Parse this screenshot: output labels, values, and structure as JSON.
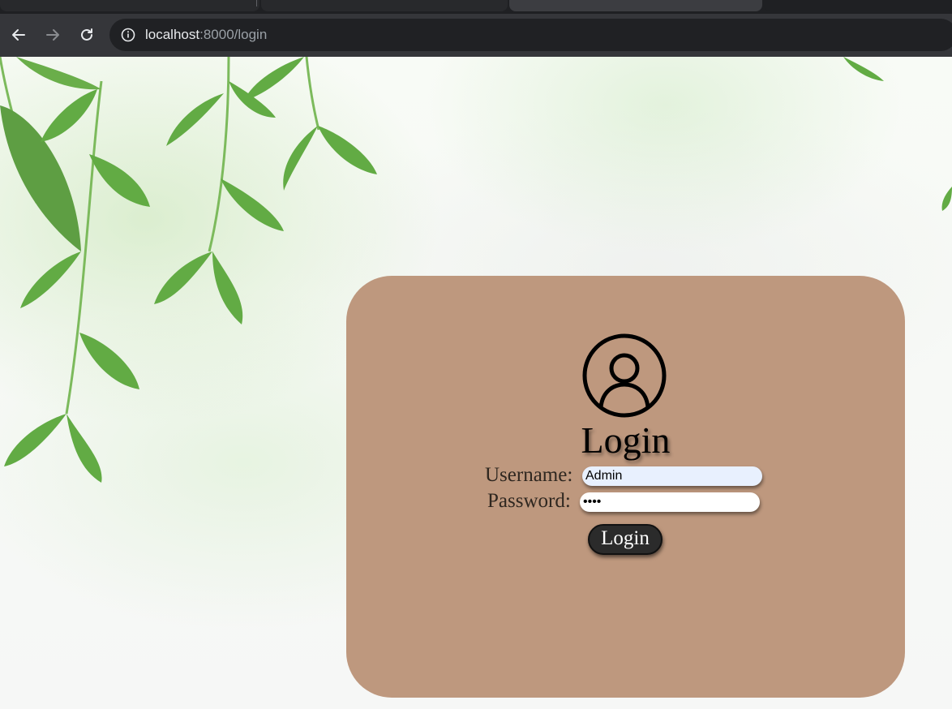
{
  "browser": {
    "url_host": "localhost",
    "url_path": ":8000/login",
    "icons": {
      "back": "arrow-left-icon",
      "forward": "arrow-right-icon",
      "reload": "reload-icon",
      "site_info": "info-icon"
    }
  },
  "login": {
    "title": "Login",
    "username_label": "Username:",
    "username_value": "Admin",
    "password_label": "Password:",
    "password_value": "••••",
    "submit_label": "Login",
    "avatar_icon": "user-circle-icon"
  },
  "colors": {
    "card": "#be987e",
    "button": "#2b2b2b",
    "foliage": "#5fa83f"
  }
}
